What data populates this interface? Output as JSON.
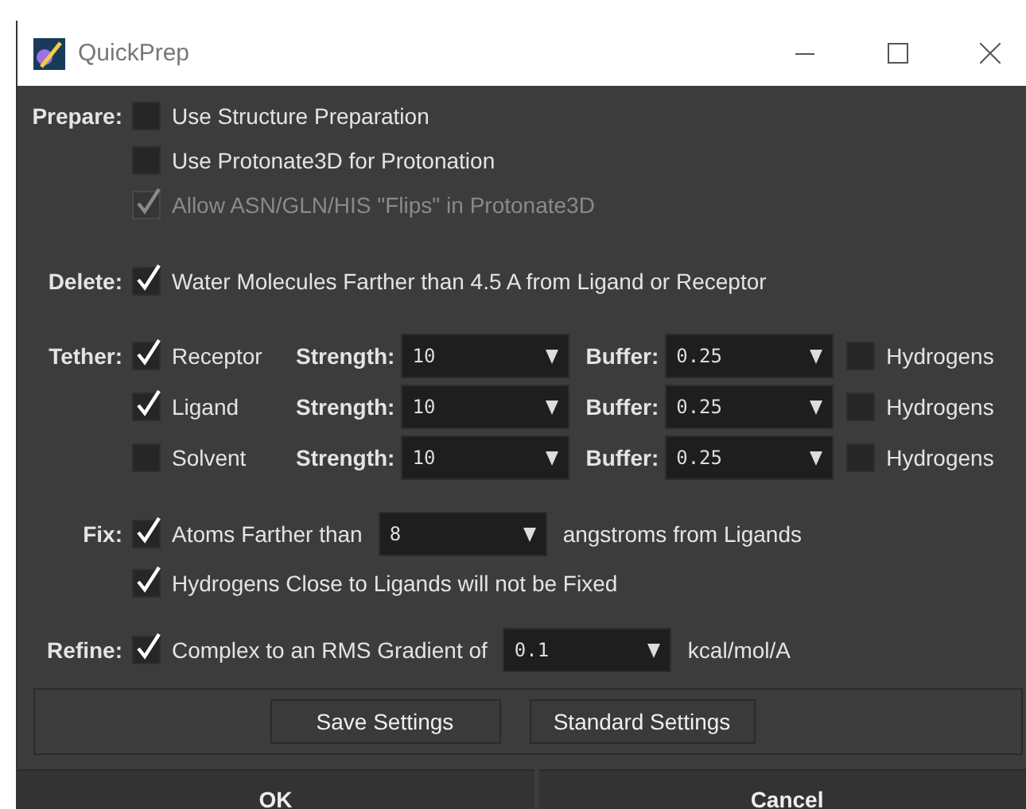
{
  "window": {
    "title": "QuickPrep"
  },
  "sections": [
    {
      "label": "Prepare:",
      "rows": [
        {
          "kind": "check",
          "text": "Use Structure Preparation",
          "checked": false,
          "disabled": false
        },
        {
          "kind": "check",
          "text": "Use Protonate3D for Protonation",
          "checked": false,
          "disabled": false
        },
        {
          "kind": "check",
          "text": "Allow ASN/GLN/HIS \"Flips\" in Protonate3D",
          "checked": true,
          "disabled": true
        }
      ]
    },
    {
      "label": "Delete:",
      "rows": [
        {
          "kind": "check",
          "text": "Water Molecules Farther than 4.5 A from Ligand or Receptor",
          "checked": true,
          "disabled": false
        }
      ]
    },
    {
      "label": "Tether:",
      "rows": [
        {
          "kind": "tether",
          "text": "Receptor",
          "checked": true,
          "strength_label": "Strength:",
          "strength": "10",
          "buffer_label": "Buffer:",
          "buffer": "0.25",
          "hydrogens_label": "Hydrogens",
          "hydrogens_checked": false
        },
        {
          "kind": "tether",
          "text": "Ligand",
          "checked": true,
          "strength_label": "Strength:",
          "strength": "10",
          "buffer_label": "Buffer:",
          "buffer": "0.25",
          "hydrogens_label": "Hydrogens",
          "hydrogens_checked": false
        },
        {
          "kind": "tether",
          "text": "Solvent",
          "checked": false,
          "strength_label": "Strength:",
          "strength": "10",
          "buffer_label": "Buffer:",
          "buffer": "0.25",
          "hydrogens_label": "Hydrogens",
          "hydrogens_checked": false
        }
      ]
    },
    {
      "label": "Fix:",
      "rows": [
        {
          "kind": "dropdown",
          "text": "Atoms Farther than",
          "checked": true,
          "value": "8",
          "suffix": "angstroms from Ligands"
        },
        {
          "kind": "check",
          "text": "Hydrogens Close to Ligands will not be Fixed",
          "checked": true,
          "disabled": false
        }
      ]
    },
    {
      "label": "Refine:",
      "rows": [
        {
          "kind": "dropdown",
          "text": "Complex to an RMS Gradient of",
          "checked": true,
          "value": "0.1",
          "suffix": "kcal/mol/A"
        }
      ]
    }
  ],
  "settings_buttons": [
    "Save Settings",
    "Standard Settings"
  ],
  "dialog_buttons": [
    "OK",
    "Cancel"
  ]
}
